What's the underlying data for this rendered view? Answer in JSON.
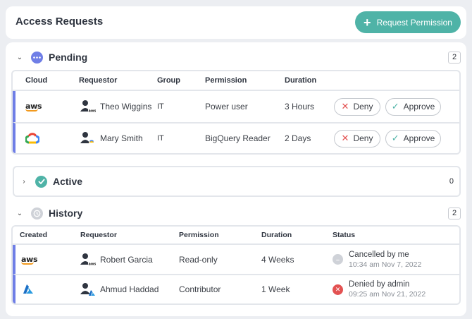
{
  "header": {
    "title": "Access Requests",
    "request_button": "Request Permission"
  },
  "pending": {
    "title": "Pending",
    "count": "2",
    "columns": [
      "Cloud",
      "Requestor",
      "Group",
      "Permission",
      "Duration"
    ],
    "rows": [
      {
        "cloud": "aws",
        "requestor": "Theo Wiggins",
        "group": "IT",
        "permission": "Power user",
        "duration": "3 Hours"
      },
      {
        "cloud": "gcp",
        "requestor": "Mary Smith",
        "group": "IT",
        "permission": "BigQuery Reader",
        "duration": "2 Days"
      }
    ],
    "deny_label": "Deny",
    "approve_label": "Approve"
  },
  "active": {
    "title": "Active",
    "count": "0"
  },
  "history": {
    "title": "History",
    "count": "2",
    "columns": [
      "Created",
      "Requestor",
      "Permission",
      "Duration",
      "Status"
    ],
    "rows": [
      {
        "cloud": "aws",
        "requestor": "Robert Garcia",
        "permission": "Read-only",
        "duration": "4 Weeks",
        "status": "Cancelled by me",
        "status_time": "10:34 am Nov 7, 2022",
        "status_type": "cancelled"
      },
      {
        "cloud": "azure",
        "requestor": "Ahmud Haddad",
        "permission": "Contributor",
        "duration": "1 Week",
        "status": "Denied by admin",
        "status_time": "09:25 am Nov 21, 2022",
        "status_type": "denied"
      }
    ]
  },
  "colors": {
    "accent": "#4fb3a7",
    "row_marker": "#6f7ee6",
    "deny": "#e35252",
    "pending_icon": "#6f7ee6",
    "active_icon": "#4fb3a7",
    "history_icon": "#cfd2d8"
  },
  "icons": {
    "chevron_down": "chevron-down-icon",
    "chevron_right": "chevron-right-icon",
    "pending": "more-dots-icon",
    "active": "check-circle-icon",
    "history": "clock-icon"
  }
}
